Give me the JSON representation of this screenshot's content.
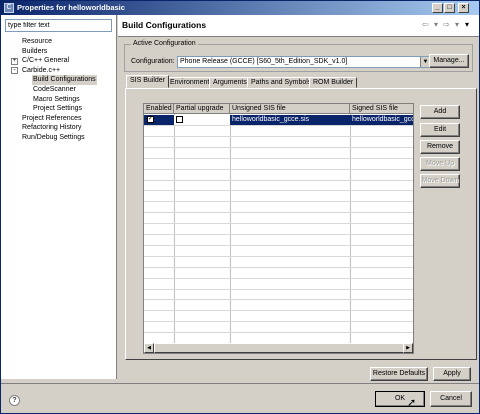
{
  "window": {
    "title": "Properties for helloworldbasic",
    "app_icon": "C"
  },
  "filter": {
    "placeholder": "type filter text",
    "value": "type filter text"
  },
  "tree": [
    {
      "label": "Resource",
      "indent": 1,
      "expander": ""
    },
    {
      "label": "Builders",
      "indent": 1,
      "expander": ""
    },
    {
      "label": "C/C++ General",
      "indent": 1,
      "expander": "+"
    },
    {
      "label": "Carbide.c++",
      "indent": 1,
      "expander": "-"
    },
    {
      "label": "Build Configurations",
      "indent": 2,
      "expander": "",
      "selected": true
    },
    {
      "label": "CodeScanner",
      "indent": 2,
      "expander": ""
    },
    {
      "label": "Macro Settings",
      "indent": 2,
      "expander": ""
    },
    {
      "label": "Project Settings",
      "indent": 2,
      "expander": ""
    },
    {
      "label": "Project References",
      "indent": 1,
      "expander": ""
    },
    {
      "label": "Refactoring History",
      "indent": 1,
      "expander": ""
    },
    {
      "label": "Run/Debug Settings",
      "indent": 1,
      "expander": ""
    }
  ],
  "header": {
    "title": "Build Configurations"
  },
  "active_config": {
    "legend": "Active Configuration",
    "label": "Configuration:",
    "selected": "Phone Release (GCCE) [S60_5th_Edition_SDK_v1.0]",
    "manage_label": "Manage..."
  },
  "tabs": [
    "SIS Builder",
    "Environment",
    "Arguments",
    "Paths and Symbols",
    "ROM Builder"
  ],
  "table": {
    "columns": [
      "Enabled",
      "Partial upgrade",
      "Unsigned SIS file",
      "Signed SIS file"
    ],
    "rows": [
      {
        "enabled": true,
        "partial": false,
        "unsigned": "helloworldbasic_gcce.sis",
        "signed": "helloworldbasic_gcce"
      }
    ]
  },
  "side_buttons": {
    "add": "Add",
    "edit": "Edit",
    "remove": "Remove",
    "move_up": "Move Up",
    "move_down": "Move Down"
  },
  "bottom": {
    "restore_defaults": "Restore Defaults",
    "apply": "Apply",
    "ok": "OK",
    "cancel": "Cancel"
  },
  "colors": {
    "selection": "#0a246a",
    "title_gradient_end": "#a6caf0"
  }
}
